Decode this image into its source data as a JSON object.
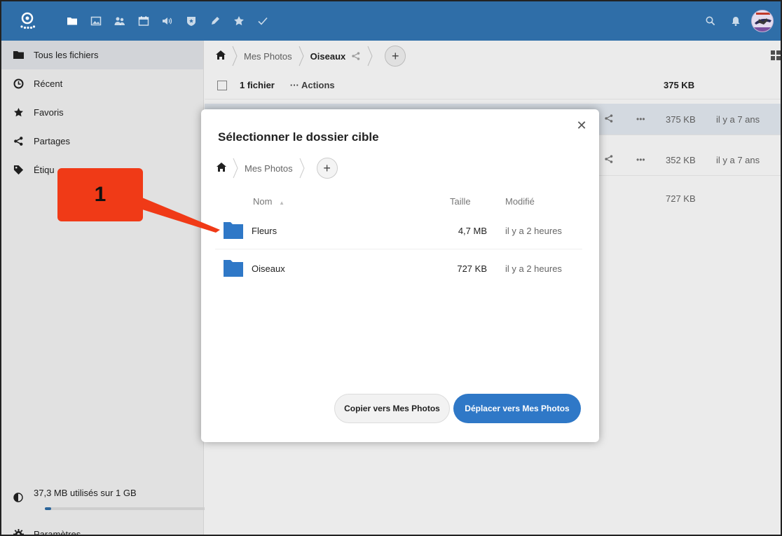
{
  "colors": {
    "header": "#2f6ea8",
    "accent": "#2f78c7",
    "callout": "#f03a17",
    "selected_row": "#e5ecf4"
  },
  "header": {
    "apps": [
      "files-icon",
      "gallery-icon",
      "contacts-icon",
      "calendar-icon",
      "audio-icon",
      "passwords-icon",
      "notes-icon",
      "bookmarks-icon",
      "tasks-icon"
    ],
    "right": [
      "search-icon",
      "notifications-icon",
      "user-avatar"
    ]
  },
  "sidebar": {
    "items": [
      {
        "label": "Tous les fichiers",
        "icon": "folder-icon"
      },
      {
        "label": "Récent",
        "icon": "clock-icon"
      },
      {
        "label": "Favoris",
        "icon": "star-icon"
      },
      {
        "label": "Partages",
        "icon": "share-icon"
      },
      {
        "label": "Étiqu",
        "icon": "tag-icon"
      }
    ],
    "quota_label": "37,3 MB utilisés sur 1 GB",
    "quota_fraction": 0.037,
    "settings_label": "Paramètres"
  },
  "main": {
    "breadcrumb": [
      "Mes Photos",
      "Oiseaux"
    ],
    "actionbar": {
      "count": "1 fichier",
      "actions": "··· Actions",
      "size": "375 KB"
    },
    "rows": [
      {
        "size": "375 KB",
        "date": "il y a 7 ans"
      },
      {
        "size": "352 KB",
        "date": "il y a 7 ans"
      }
    ],
    "total": "727 KB"
  },
  "dialog": {
    "title": "Sélectionner le dossier cible",
    "breadcrumb": "Mes Photos",
    "columns": {
      "name": "Nom",
      "size": "Taille",
      "modified": "Modifié"
    },
    "folders": [
      {
        "name": "Fleurs",
        "size": "4,7 MB",
        "modified": "il y a 2 heures"
      },
      {
        "name": "Oiseaux",
        "size": "727 KB",
        "modified": "il y a 2 heures"
      }
    ],
    "copy_label": "Copier vers Mes Photos",
    "move_label": "Déplacer vers Mes Photos"
  },
  "annotation": {
    "label": "1"
  }
}
